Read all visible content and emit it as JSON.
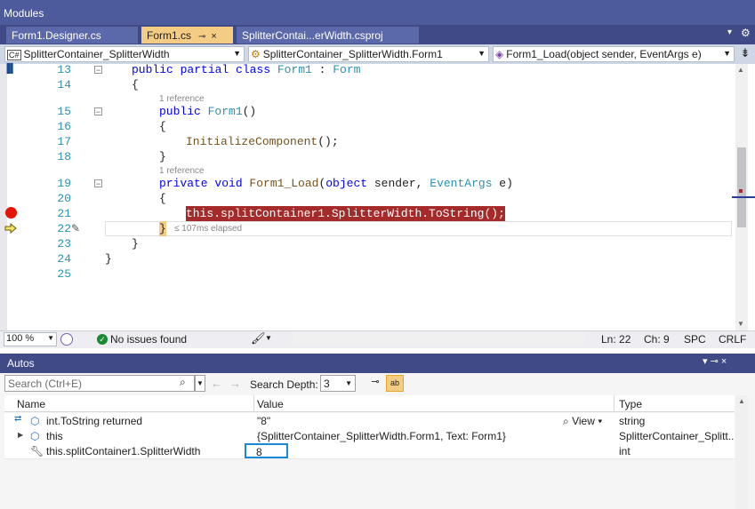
{
  "modules_bar": {
    "label": "Modules"
  },
  "tabs": [
    {
      "label": "Form1.Designer.cs",
      "active": false
    },
    {
      "label": "Form1.cs",
      "active": true,
      "pin": "⊸",
      "close": "×"
    },
    {
      "label": "SplitterContai...erWidth.csproj",
      "active": false
    }
  ],
  "nav": {
    "project": "SplitterContainer_SplitterWidth",
    "project_icon": "C#",
    "type": "SplitterContainer_SplitterWidth.Form1",
    "member": "Form1_Load(object sender, EventArgs e)"
  },
  "code": {
    "line_numbers": [
      "13",
      "14",
      "15",
      "16",
      "17",
      "18",
      "19",
      "20",
      "21",
      "22",
      "23",
      "24",
      "25"
    ],
    "codelens_ctor": "1 reference",
    "codelens_load": "1 reference",
    "l13_kw": "public partial class ",
    "l13_type": "Form1",
    "l13_colon": " : ",
    "l13_base": "Form",
    "l14": "{",
    "l15_kw": "public ",
    "l15_name": "Form1",
    "l15_rest": "()",
    "l16": "{",
    "l17_call": "InitializeComponent",
    "l17_rest": "();",
    "l18": "}",
    "l19_kw": "private void ",
    "l19_name": "Form1_Load",
    "l19_p1": "(",
    "l19_kw2": "object",
    "l19_p2": " sender, ",
    "l19_type": "EventArgs",
    "l19_p3": " e)",
    "l20": "{",
    "l21": "this.splitContainer1.SplitterWidth.ToString();",
    "l22": "}",
    "l23": "}",
    "l24": "}",
    "elapsed": "≤ 107ms elapsed"
  },
  "status": {
    "zoom": "100 %",
    "issues": "No issues found",
    "ln": "Ln: 22",
    "ch": "Ch: 9",
    "spc": "SPC",
    "crlf": "CRLF"
  },
  "autos": {
    "title": "Autos",
    "controls": "▾ ⊸ ×",
    "search_placeholder": "Search (Ctrl+E)",
    "search_depth_label": "Search Depth:",
    "search_depth": "3",
    "columns": [
      "Name",
      "Value",
      "Type"
    ],
    "rows": [
      {
        "name": "int.ToString returned",
        "value": "\"8\"",
        "view": "View",
        "type": "string"
      },
      {
        "name": "this",
        "value": "{SplitterContainer_SplitterWidth.Form1, Text: Form1}",
        "type": "SplitterContainer_Splitt..."
      },
      {
        "name": "this.splitContainer1.SplitterWidth",
        "value": "8",
        "type": "int"
      }
    ]
  },
  "colors": {
    "title_bar": "#4d5a9b",
    "tab_active": "#f5cc84",
    "breakpoint": "#e51400",
    "highlight": "#a52a2a"
  }
}
